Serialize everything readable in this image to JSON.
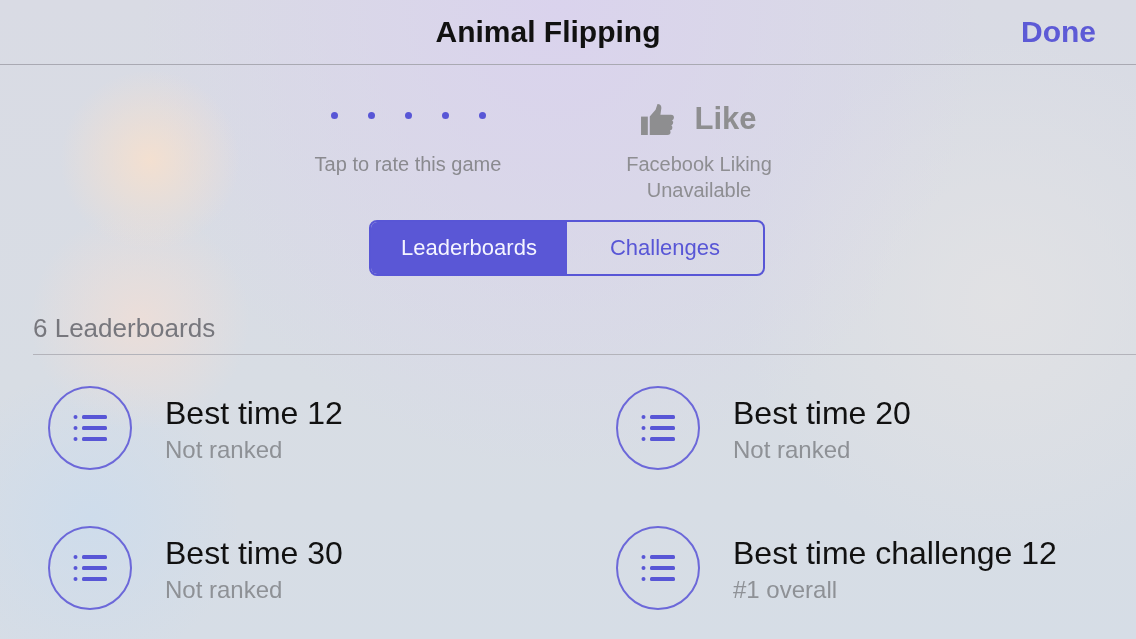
{
  "nav_bar": {
    "title": "Animal Flipping",
    "done_button": "Done"
  },
  "rating": {
    "hint": "Tap to rate this game"
  },
  "like": {
    "label": "Like",
    "disabled": true,
    "status": "Facebook Liking Unavailable"
  },
  "tabs": [
    {
      "label": "Leaderboards",
      "selected": true
    },
    {
      "label": "Challenges",
      "selected": false
    }
  ],
  "section": {
    "title": "6 Leaderboards"
  },
  "leaderboards": [
    {
      "title": "Best time 12",
      "subtitle": "Not ranked"
    },
    {
      "title": "Best time 20",
      "subtitle": "Not ranked"
    },
    {
      "title": "Best time 30",
      "subtitle": "Not ranked"
    },
    {
      "title": "Best time challenge 12",
      "subtitle": "#1 overall"
    }
  ]
}
